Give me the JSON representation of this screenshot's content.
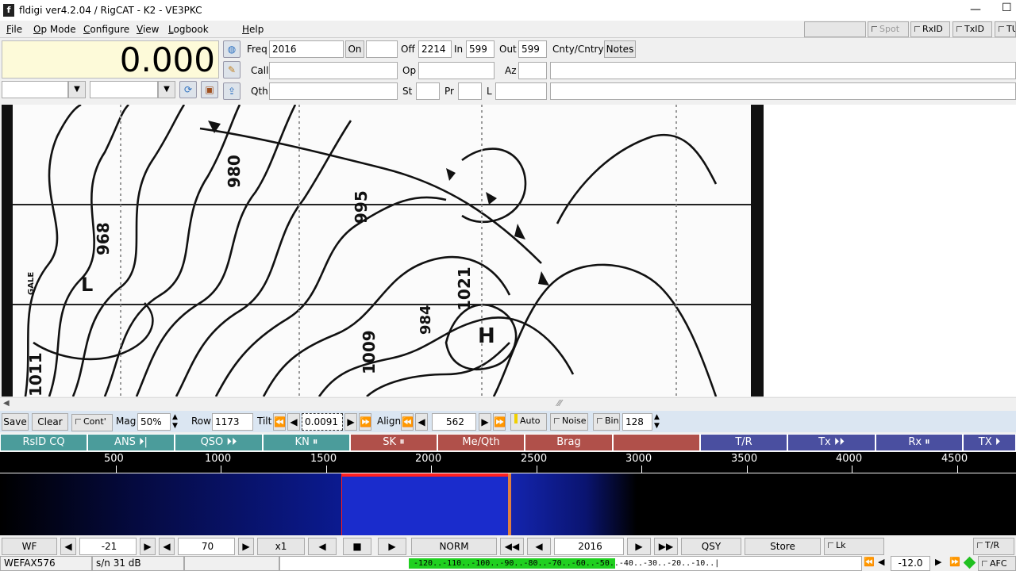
{
  "window": {
    "title": "fldigi ver4.2.04 / RigCAT - K2 - VE3PKC",
    "min": "—",
    "max": "☐"
  },
  "menu": [
    "File",
    "Op Mode",
    "Configure",
    "View",
    "Logbook",
    "Help"
  ],
  "toolbar_toggles": {
    "spot": "Spot",
    "rxid": "RxID",
    "txid": "TxID",
    "tune": "TUNE"
  },
  "frequency": "0.000",
  "log": {
    "freq_label": "Freq",
    "freq_value": "2016",
    "on_label": "On",
    "on_value": "",
    "off_label": "Off",
    "off_value": "2214",
    "in_label": "In",
    "in_value": "599",
    "out_label": "Out",
    "out_value": "599",
    "cnty_label": "Cnty/Cntry",
    "notes_label": "Notes",
    "call_label": "Call",
    "op_label": "Op",
    "az_label": "Az",
    "qth_label": "Qth",
    "st_label": "St",
    "pr_label": "Pr",
    "l_label": "L"
  },
  "map_labels": [
    "980",
    "995",
    "968",
    "1021",
    "1009",
    "1011",
    "GALE",
    "H",
    "L",
    "984"
  ],
  "wefax": {
    "save": "Save",
    "clear": "Clear",
    "cont": "Cont'",
    "mag_label": "Mag",
    "mag_value": "50%",
    "row_label": "Row",
    "row_value": "1173",
    "tilt_label": "Tilt",
    "tilt_value": "0.0091",
    "align_label": "Align",
    "align_value": "562",
    "auto": "Auto",
    "noise": "Noise",
    "bin": "Bin",
    "bin_value": "128"
  },
  "macros": [
    {
      "label": "RsID CQ",
      "color": "teal"
    },
    {
      "label": "ANS ⏵|",
      "color": "teal"
    },
    {
      "label": "QSO ⏵⏵",
      "color": "teal"
    },
    {
      "label": "KN ⏸",
      "color": "teal"
    },
    {
      "label": "SK ⏸",
      "color": "brown"
    },
    {
      "label": "Me/Qth",
      "color": "brown"
    },
    {
      "label": "Brag",
      "color": "brown"
    },
    {
      "label": "",
      "color": "brown"
    },
    {
      "label": "T/R",
      "color": "blue"
    },
    {
      "label": "Tx ⏵⏵",
      "color": "blue"
    },
    {
      "label": "Rx ⏸",
      "color": "blue"
    },
    {
      "label": "TX ⏵",
      "color": "blue"
    }
  ],
  "scale": {
    "ticks": [
      "500",
      "1000",
      "1500",
      "2000",
      "2500",
      "3000",
      "3500",
      "4000",
      "4500"
    ]
  },
  "colors": {
    "tune_marker": "#ff2020",
    "carrier": "#e08040",
    "signal": "#1a2ccc"
  },
  "waterfall_controls": {
    "wf": "WF",
    "low": "-21",
    "range": "70",
    "speed": "x1",
    "mode": "NORM",
    "freq": "2016",
    "qsy": "QSY",
    "store": "Store",
    "lk": "Lk",
    "tr": "T/R"
  },
  "status": {
    "mode": "WEFAX576",
    "sn": "s/n  31 dB",
    "meter": "-120..-110..-100..-90..-80..-70..-60..-50..-40..-30..-20..-10..|",
    "offset": "-12.0",
    "afc": "AFC"
  }
}
